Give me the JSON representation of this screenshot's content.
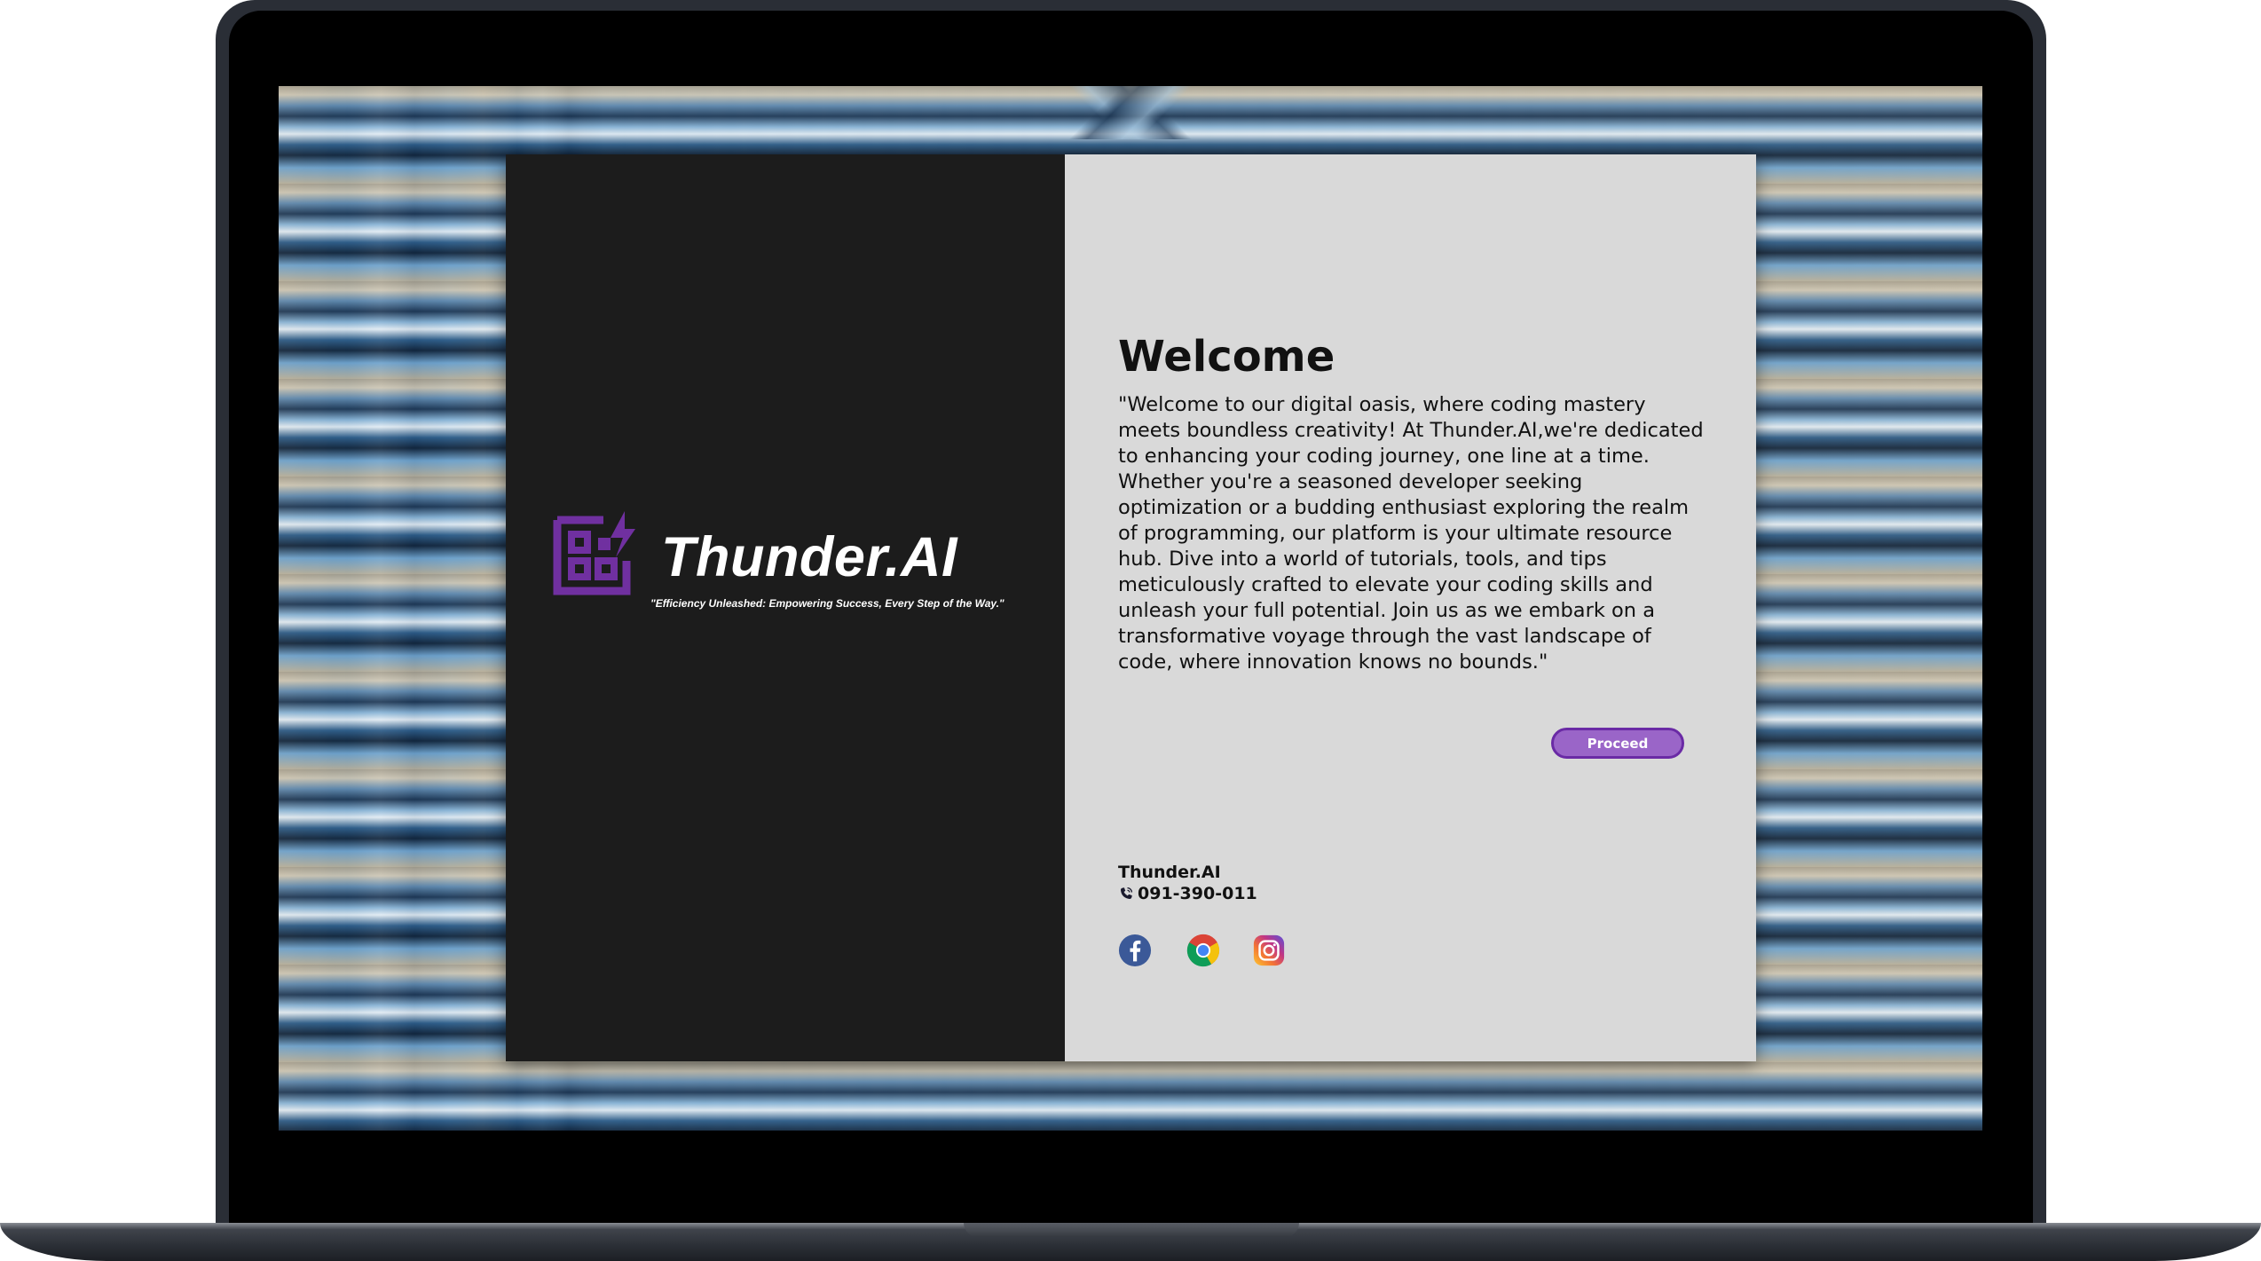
{
  "brand": {
    "name": "Thunder.AI",
    "tagline": "\"Efficiency Unleashed: Empowering Success, Every Step of the Way.\"",
    "accent_color": "#7030a0",
    "logo_icon": "grid-lightning-icon"
  },
  "welcome": {
    "title": "Welcome",
    "body": "\"Welcome to our digital oasis, where coding mastery meets boundless creativity! At Thunder.AI,we're dedicated to enhancing your coding journey, one line at a time. Whether you're a seasoned developer seeking optimization or a budding enthusiast exploring the realm of programming, our platform is your ultimate resource hub. Dive into a world of tutorials, tools, and tips meticulously crafted to elevate your coding skills and unleash your full potential. Join us as we embark on a transformative voyage through the vast landscape of code, where innovation knows no bounds.\""
  },
  "actions": {
    "proceed_label": "Proceed",
    "proceed_color": "#9a65c8"
  },
  "footer": {
    "company": "Thunder.AI",
    "phone": "091-390-011",
    "phone_icon": "phone-icon",
    "social": [
      {
        "icon": "facebook-icon",
        "color": "#3b5998"
      },
      {
        "icon": "chrome-icon",
        "color": "#db4437"
      },
      {
        "icon": "instagram-icon",
        "color": "#c13584"
      }
    ]
  },
  "theme": {
    "left_panel_bg": "#1c1c1c",
    "right_panel_bg": "#d9d9d9"
  }
}
